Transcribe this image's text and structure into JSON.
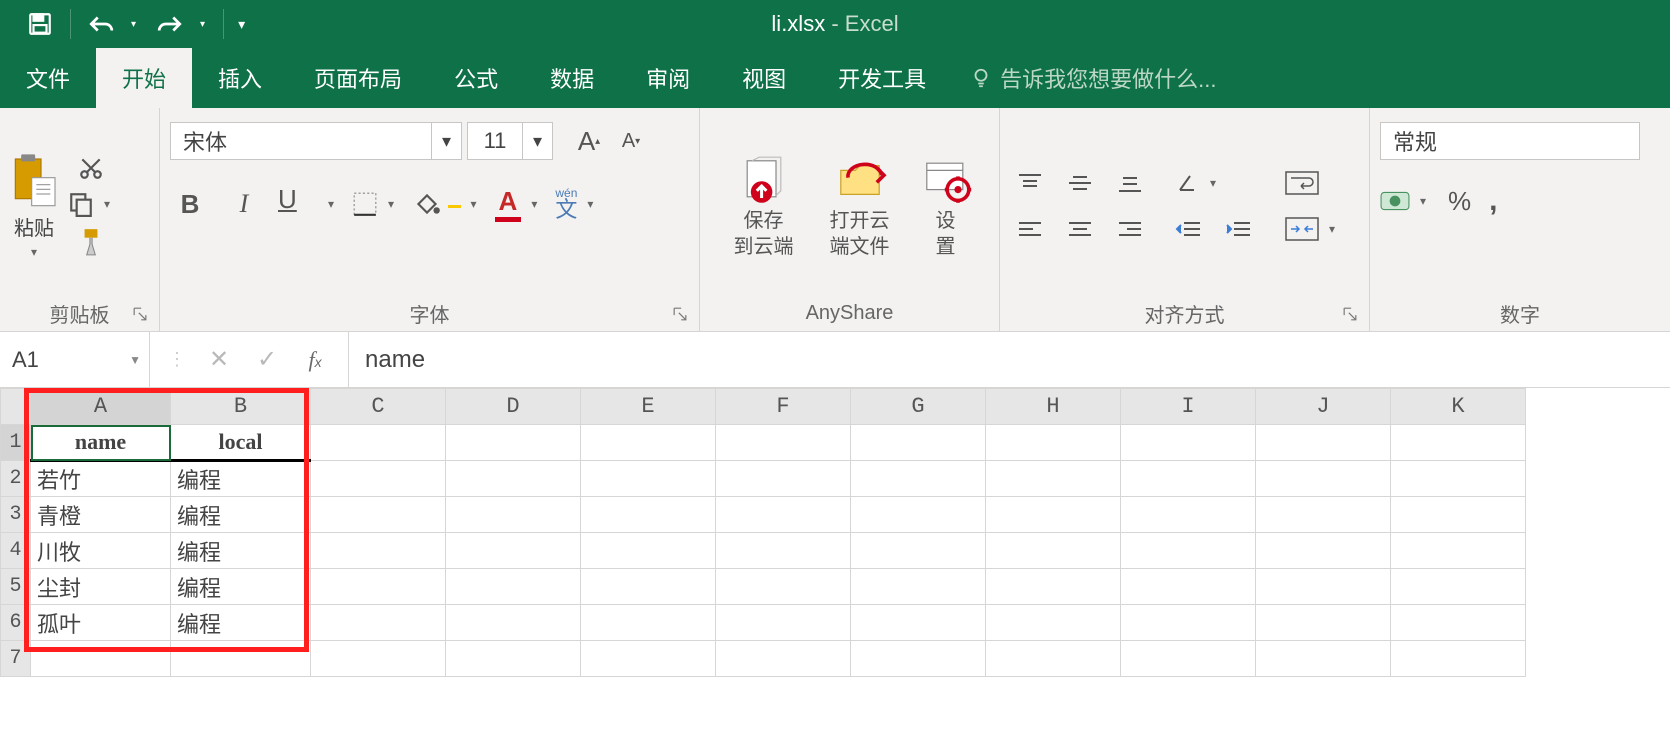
{
  "titlebar": {
    "file": "li.xlsx",
    "app": "Excel"
  },
  "tabs": {
    "items": [
      "文件",
      "开始",
      "插入",
      "页面布局",
      "公式",
      "数据",
      "审阅",
      "视图",
      "开发工具"
    ],
    "active_index": 1,
    "tell_me": "告诉我您想要做什么..."
  },
  "ribbon": {
    "clipboard": {
      "label": "剪贴板",
      "paste": "粘贴"
    },
    "font": {
      "label": "字体",
      "name": "宋体",
      "size": "11",
      "bold": "B",
      "italic": "I",
      "underline": "U",
      "wen": "wén",
      "wen_sub": "文"
    },
    "anyshare": {
      "label": "AnyShare",
      "save_cloud": "保存\n到云端",
      "open_cloud": "打开云\n端文件",
      "settings": "设\n置"
    },
    "align": {
      "label": "对齐方式"
    },
    "number": {
      "label": "数字",
      "format": "常规",
      "percent": "%",
      "comma": ","
    }
  },
  "formula_bar": {
    "name_box": "A1",
    "value": "name"
  },
  "sheet": {
    "columns": [
      "A",
      "B",
      "C",
      "D",
      "E",
      "F",
      "G",
      "H",
      "I",
      "J",
      "K"
    ],
    "row_numbers": [
      "1",
      "2",
      "3",
      "4",
      "5",
      "6",
      "7"
    ],
    "headers": {
      "A": "name",
      "B": "local"
    },
    "rows": [
      {
        "A": "若竹",
        "B": "编程"
      },
      {
        "A": "青橙",
        "B": "编程"
      },
      {
        "A": "川牧",
        "B": "编程"
      },
      {
        "A": "尘封",
        "B": "编程"
      },
      {
        "A": "孤叶",
        "B": "编程"
      }
    ],
    "active_cell": "A1"
  }
}
